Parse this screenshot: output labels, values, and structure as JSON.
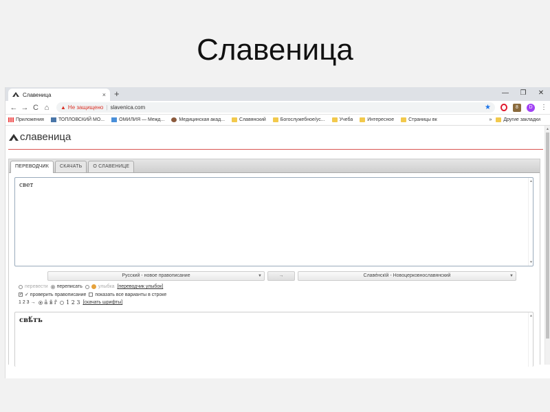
{
  "slide": {
    "title": "Славеница"
  },
  "browser": {
    "tab": {
      "title": "Славеница",
      "close": "×"
    },
    "new_tab": "+",
    "window_controls": [
      "—",
      "❐",
      "✕"
    ],
    "nav": {
      "back": "←",
      "forward": "→",
      "reload": "C",
      "home": "⌂"
    },
    "omnibox": {
      "security_text": "Не защищено",
      "separator": "|",
      "url": "slavenica.com"
    },
    "extension_badge": "8",
    "avatar_letter": "D",
    "menu": "⋮",
    "bookmarks": [
      {
        "label": "Приложения",
        "icon": "apps"
      },
      {
        "label": "ТОПЛОВСКИЙ МО...",
        "icon": "vk"
      },
      {
        "label": "ОМИЛИЯ — Межд...",
        "icon": "blue"
      },
      {
        "label": "Медицинская акад...",
        "icon": "brown"
      },
      {
        "label": "Славянский",
        "icon": "folder"
      },
      {
        "label": "Богослужебное/ус...",
        "icon": "folder"
      },
      {
        "label": "Учеба",
        "icon": "folder"
      },
      {
        "label": "Интересное",
        "icon": "folder"
      },
      {
        "label": "Страницы вк",
        "icon": "folder"
      }
    ],
    "bookmarks_more": "»",
    "other_bookmarks": "Другие закладки"
  },
  "site": {
    "logo_text": "славеница",
    "tabs": [
      {
        "label": "ПЕРЕВОДЧИК",
        "active": true
      },
      {
        "label": "СКАЧАТЬ",
        "active": false
      },
      {
        "label": "О СЛАВЕНИЦЕ",
        "active": false
      }
    ],
    "source_text": "свет",
    "source_lang": "Русский - новое правописание",
    "swap_label": "→",
    "target_lang": "Славе́нскїй - Новоцерковнославянский",
    "options": {
      "translate": "перевести",
      "transcribe": "переписать",
      "smile": "улыбка",
      "smile_link": "[переводчик улыбок]",
      "spellcheck": "✓ проверить правописание",
      "show_all": "показать все варианты в строке",
      "digits_prefix": "1 2 3 →",
      "digits_slav": "а̃ в̃ г̃",
      "digits_plain": "1 2 3",
      "fonts_link": "[скачать шрифты]"
    },
    "output_text": "свѣ́тъ"
  }
}
